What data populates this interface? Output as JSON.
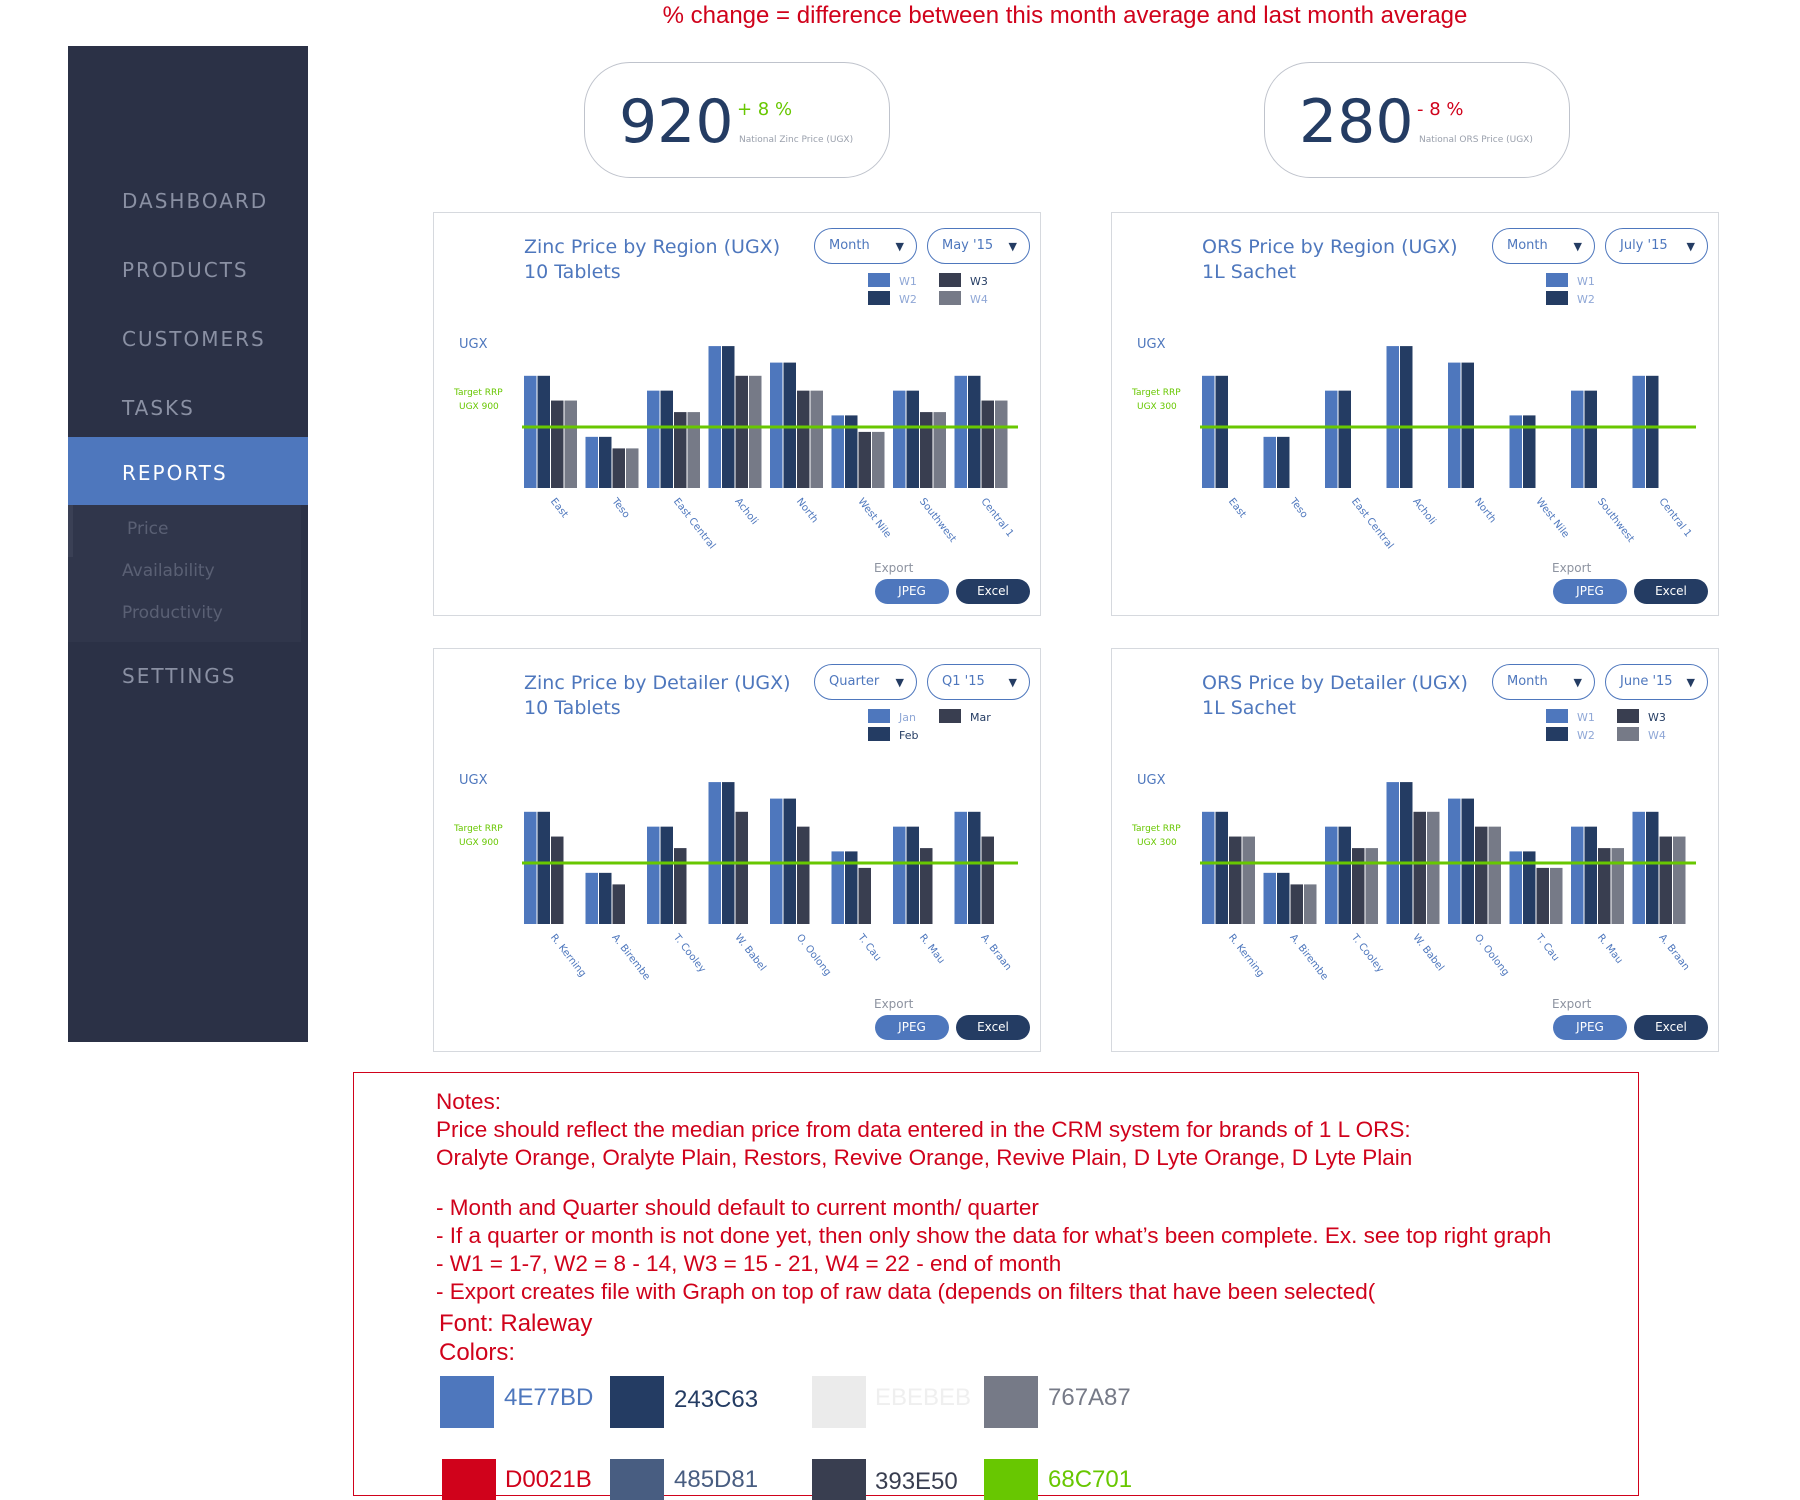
{
  "top_note": "% change = difference between this month average and last month average",
  "colors": {
    "blue": "#4E77BD",
    "navy": "#243C63",
    "dark": "#393E50",
    "gray": "#767A87",
    "green": "#68C701",
    "red": "#D0021B",
    "steel": "#485D81",
    "light": "#EBEBEB",
    "sidebar": "#2B3146"
  },
  "sidebar": {
    "items": [
      "DASHBOARD",
      "PRODUCTS",
      "CUSTOMERS",
      "TASKS"
    ],
    "active": "REPORTS",
    "subitems": [
      "Price",
      "Availability",
      "Productivity"
    ],
    "last": "SETTINGS"
  },
  "kpis": [
    {
      "value": "920",
      "delta": "+ 8 %",
      "delta_color": "#68C701",
      "label": "National Zinc Price (UGX)"
    },
    {
      "value": "280",
      "delta": "- 8 %",
      "delta_color": "#D0021B",
      "label": "National ORS Price (UGX)"
    }
  ],
  "cards": [
    {
      "title1": "Zinc Price by Region (UGX)",
      "title2": "10 Tablets",
      "dd1": "Month",
      "dd2": "May '15",
      "export": "Export",
      "jpeg": "JPEG",
      "excel": "Excel"
    },
    {
      "title1": "ORS Price by Region (UGX)",
      "title2": "1L Sachet",
      "dd1": "Month",
      "dd2": "July '15",
      "export": "Export",
      "jpeg": "JPEG",
      "excel": "Excel"
    },
    {
      "title1": "Zinc Price by Detailer (UGX)",
      "title2": "10 Tablets",
      "dd1": "Quarter",
      "dd2": "Q1 '15",
      "export": "Export",
      "jpeg": "JPEG",
      "excel": "Excel"
    },
    {
      "title1": "ORS Price by Detailer (UGX)",
      "title2": "1L Sachet",
      "dd1": "Month",
      "dd2": "June '15",
      "export": "Export",
      "jpeg": "JPEG",
      "excel": "Excel"
    }
  ],
  "chart_data": [
    {
      "type": "bar",
      "ylabel": "UGX",
      "target_label": [
        "Target RRP",
        "UGX 900"
      ],
      "target_frac": 0.37,
      "categories": [
        "East",
        "Teso",
        "East Central",
        "Acholi",
        "North",
        "West Nile",
        "Southwest",
        "Central 1"
      ],
      "series": [
        {
          "name": "W1",
          "color": "#4E77BD",
          "values": [
            0.68,
            0.31,
            0.59,
            0.86,
            0.76,
            0.44,
            0.59,
            0.68
          ]
        },
        {
          "name": "W2",
          "color": "#243C63",
          "values": [
            0.68,
            0.31,
            0.59,
            0.86,
            0.76,
            0.44,
            0.59,
            0.68
          ]
        },
        {
          "name": "W3",
          "color": "#393E50",
          "values": [
            0.53,
            0.24,
            0.46,
            0.68,
            0.59,
            0.34,
            0.46,
            0.53
          ]
        },
        {
          "name": "W4",
          "color": "#767A87",
          "values": [
            0.53,
            0.24,
            0.46,
            0.68,
            0.59,
            0.34,
            0.46,
            0.53
          ]
        }
      ]
    },
    {
      "type": "bar",
      "ylabel": "UGX",
      "target_label": [
        "Target RRP",
        "UGX 300"
      ],
      "target_frac": 0.37,
      "categories": [
        "East",
        "Teso",
        "East Central",
        "Acholi",
        "North",
        "West Nile",
        "Southwest",
        "Central 1"
      ],
      "series": [
        {
          "name": "W1",
          "color": "#4E77BD",
          "values": [
            0.68,
            0.31,
            0.59,
            0.86,
            0.76,
            0.44,
            0.59,
            0.68
          ]
        },
        {
          "name": "W2",
          "color": "#243C63",
          "values": [
            0.68,
            0.31,
            0.59,
            0.86,
            0.76,
            0.44,
            0.59,
            0.68
          ]
        }
      ]
    },
    {
      "type": "bar",
      "ylabel": "UGX",
      "target_label": [
        "Target RRP",
        "UGX 900"
      ],
      "target_frac": 0.37,
      "categories": [
        "R. Kerning",
        "A. Birembe",
        "T. Cooley",
        "W. Babel",
        "O. Oolong",
        "T. Cau",
        "R. Mau",
        "A. Braan"
      ],
      "series": [
        {
          "name": "Jan",
          "color": "#4E77BD",
          "values": [
            0.68,
            0.31,
            0.59,
            0.86,
            0.76,
            0.44,
            0.59,
            0.68
          ]
        },
        {
          "name": "Feb",
          "color": "#243C63",
          "values": [
            0.68,
            0.31,
            0.59,
            0.86,
            0.76,
            0.44,
            0.59,
            0.68
          ]
        },
        {
          "name": "Mar",
          "color": "#393E50",
          "values": [
            0.53,
            0.24,
            0.46,
            0.68,
            0.59,
            0.34,
            0.46,
            0.53
          ]
        }
      ]
    },
    {
      "type": "bar",
      "ylabel": "UGX",
      "target_label": [
        "Target RRP",
        "UGX 300"
      ],
      "target_frac": 0.37,
      "categories": [
        "R. Kerning",
        "A. Birembe",
        "T. Cooley",
        "W. Babel",
        "O. Oolong",
        "T. Cau",
        "R. Mau",
        "A. Braan"
      ],
      "series": [
        {
          "name": "W1",
          "color": "#4E77BD",
          "values": [
            0.68,
            0.31,
            0.59,
            0.86,
            0.76,
            0.44,
            0.59,
            0.68
          ]
        },
        {
          "name": "W2",
          "color": "#243C63",
          "values": [
            0.68,
            0.31,
            0.59,
            0.86,
            0.76,
            0.44,
            0.59,
            0.68
          ]
        },
        {
          "name": "W3",
          "color": "#393E50",
          "values": [
            0.53,
            0.24,
            0.46,
            0.68,
            0.59,
            0.34,
            0.46,
            0.53
          ]
        },
        {
          "name": "W4",
          "color": "#767A87",
          "values": [
            0.53,
            0.24,
            0.46,
            0.68,
            0.59,
            0.34,
            0.46,
            0.53
          ]
        }
      ]
    }
  ],
  "notes": {
    "lines": [
      "Notes:",
      "Price should reflect the median price from data entered in the CRM system for brands of 1 L ORS:",
      "Oralyte Orange, Oralyte Plain, Restors, Revive Orange, Revive Plain, D Lyte Orange, D Lyte Plain",
      "- Month and Quarter should default to current month/ quarter",
      "- If a quarter or month is not done yet, then only show the data for what’s been complete. Ex. see top right graph",
      "- W1 = 1-7, W2 = 8 - 14, W3 = 15 - 21, W4 = 22 - end of month",
      "- Export creates file with Graph on top of raw data (depends on filters that have been selected(",
      "Font: Raleway",
      "Colors:"
    ],
    "swatches": [
      {
        "hex": "#4E77BD",
        "label": "4E77BD"
      },
      {
        "hex": "#243C63",
        "label": "243C63"
      },
      {
        "hex": "#EBEBEB",
        "label": "EBEBEB"
      },
      {
        "hex": "#767A87",
        "label": "767A87"
      },
      {
        "hex": "#D0021B",
        "label": "D0021B"
      },
      {
        "hex": "#485D81",
        "label": "485D81"
      },
      {
        "hex": "#393E50",
        "label": "393E50"
      },
      {
        "hex": "#68C701",
        "label": "68C701"
      }
    ]
  }
}
